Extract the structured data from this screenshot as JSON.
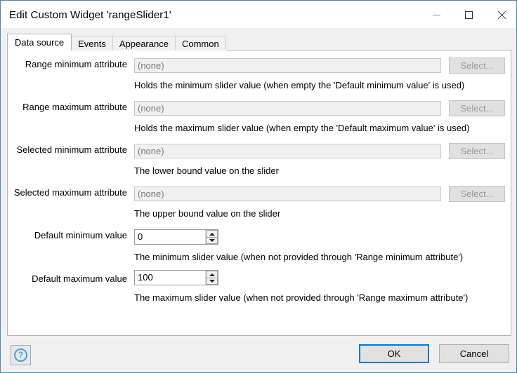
{
  "window": {
    "title": "Edit Custom Widget 'rangeSlider1'",
    "controls": {
      "minimize": "—",
      "maximize": "□",
      "close": "✕"
    },
    "accent_color": "#0078d7",
    "border_color": "#4a8ca8"
  },
  "tabs": [
    {
      "label": "Data source",
      "active": true
    },
    {
      "label": "Events",
      "active": false
    },
    {
      "label": "Appearance",
      "active": false
    },
    {
      "label": "Common",
      "active": false
    }
  ],
  "form": {
    "rows": [
      {
        "label": "Range minimum attribute",
        "type": "select",
        "value": "(none)",
        "button": "Select...",
        "description": "Holds the minimum slider value (when empty the 'Default minimum value' is used)"
      },
      {
        "label": "Range maximum attribute",
        "type": "select",
        "value": "(none)",
        "button": "Select...",
        "description": "Holds the maximum slider value (when empty the 'Default maximum value' is used)"
      },
      {
        "label": "Selected minimum attribute",
        "type": "select",
        "value": "(none)",
        "button": "Select...",
        "description": "The lower bound value on the slider"
      },
      {
        "label": "Selected maximum attribute",
        "type": "select",
        "value": "(none)",
        "button": "Select...",
        "description": "The upper bound value on the slider"
      },
      {
        "label": "Default minimum value",
        "type": "spinner",
        "value": "0",
        "description": "The minimum slider value (when not provided through 'Range minimum attribute')"
      },
      {
        "label": "Default maximum value",
        "type": "spinner",
        "value": "100",
        "description": "The maximum slider value (when not provided through 'Range maximum attribute')"
      }
    ]
  },
  "footer": {
    "help": "?",
    "ok": "OK",
    "cancel": "Cancel"
  }
}
